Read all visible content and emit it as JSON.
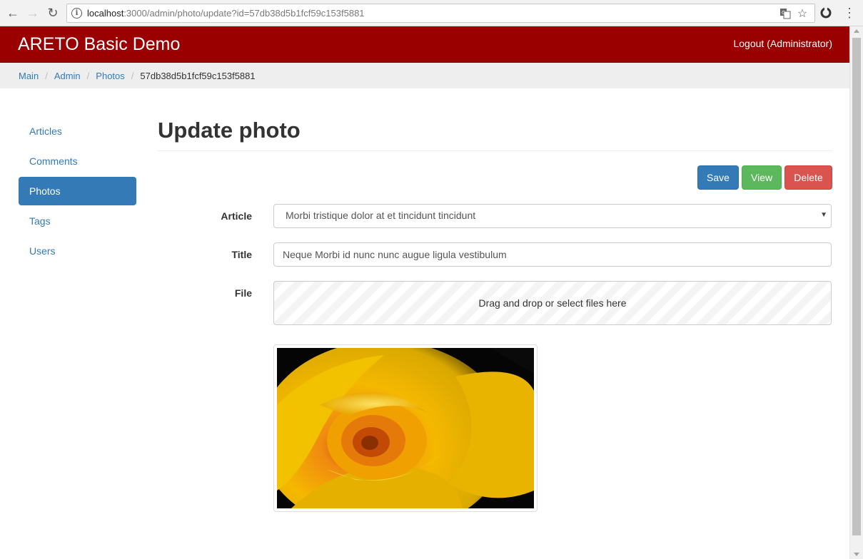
{
  "browser": {
    "url_host": "localhost",
    "url_rest": ":3000/admin/photo/update?id=57db38d5b1fcf59c153f5881",
    "icons": [
      "back-arrow-icon",
      "forward-arrow-icon",
      "reload-icon",
      "info-icon",
      "translate-icon",
      "star-icon",
      "extension-icon",
      "menu-dots-icon"
    ]
  },
  "navbar": {
    "brand": "ARETO Basic Demo",
    "logout": "Logout (Administrator)",
    "color": "#9b0000"
  },
  "breadcrumb": {
    "items": [
      "Main",
      "Admin",
      "Photos"
    ],
    "current": "57db38d5b1fcf59c153f5881"
  },
  "sidebar": {
    "items": [
      {
        "label": "Articles"
      },
      {
        "label": "Comments"
      },
      {
        "label": "Photos",
        "active": true
      },
      {
        "label": "Tags"
      },
      {
        "label": "Users"
      }
    ]
  },
  "main": {
    "title": "Update photo",
    "buttons": {
      "save": "Save",
      "view": "View",
      "delete": "Delete"
    },
    "form": {
      "article_label": "Article",
      "article_value": "Morbi tristique dolor at et tincidunt tincidunt",
      "title_label": "Title",
      "title_value": "Neque Morbi id nunc nunc augue ligula vestibulum",
      "file_label": "File",
      "dropzone_text": "Drag and drop or select files here"
    },
    "photo": {
      "subject": "yellow rose"
    }
  },
  "colors": {
    "primary": "#337ab7",
    "success": "#5cb85c",
    "danger": "#d9534f"
  }
}
